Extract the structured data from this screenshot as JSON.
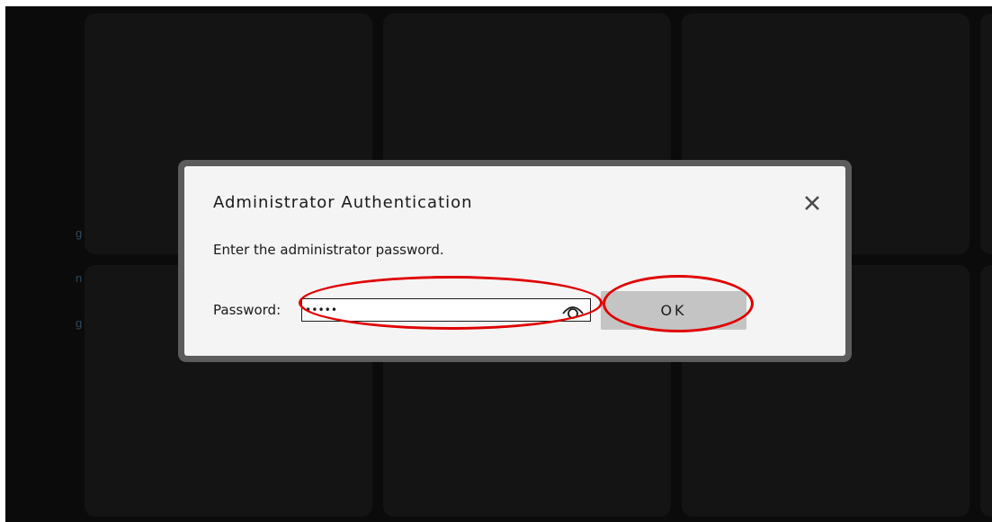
{
  "background": {
    "side_letters": [
      "g",
      "n",
      "g"
    ]
  },
  "dialog": {
    "title": "Administrator Authentication",
    "close_icon": "close-icon",
    "message": "Enter the administrator password.",
    "password_label": "Password:",
    "password_value": "•••••",
    "reveal_icon": "eye-icon",
    "ok_label": "OK"
  },
  "annotations": {
    "highlight_color": "#e00000",
    "highlighted": [
      "password-field",
      "ok-button"
    ]
  },
  "colors": {
    "screen_bg": "#0b0b0b",
    "tile_bg": "#141414",
    "dialog_frame": "#5c5c5c",
    "dialog_bg": "#f4f4f4",
    "ok_button_bg": "#c4c4c4"
  }
}
